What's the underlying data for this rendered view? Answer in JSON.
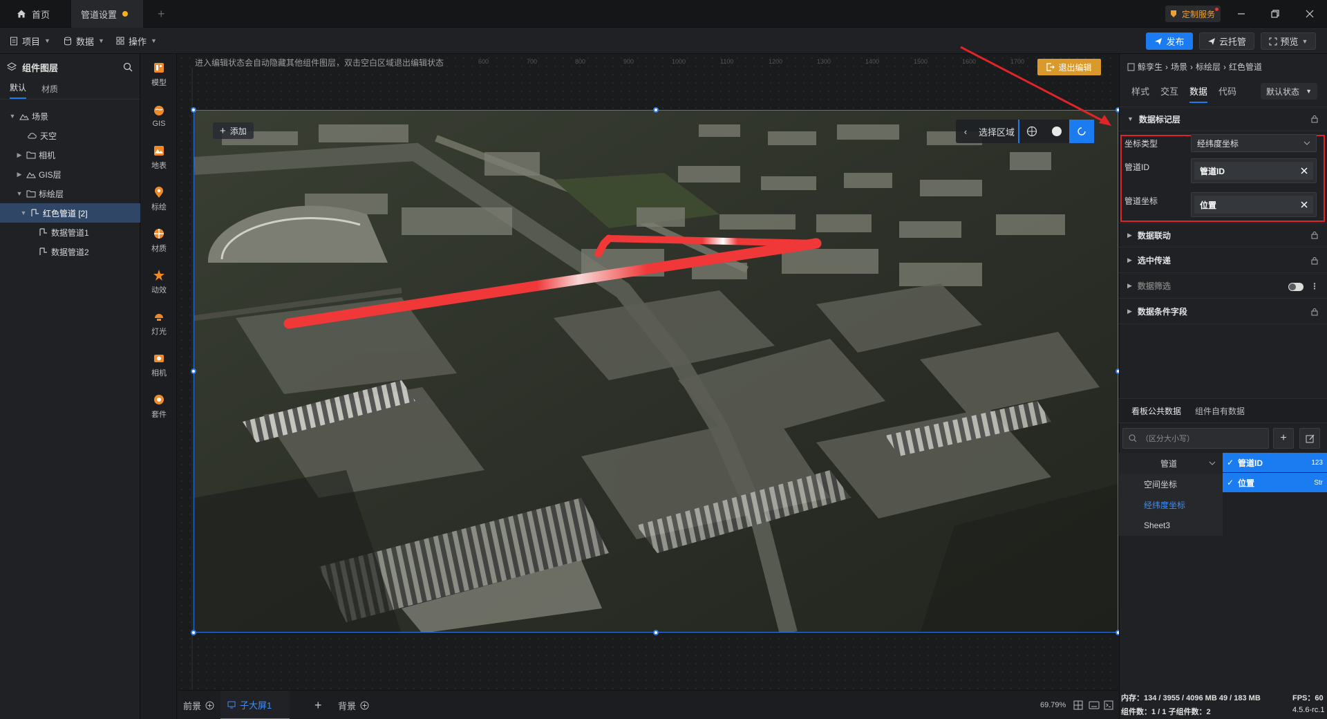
{
  "titlebar": {
    "tabs": [
      {
        "label": "首页"
      },
      {
        "label": "管道设置"
      }
    ],
    "custom_service": "定制服务"
  },
  "toolbar": {
    "menus": [
      {
        "label": "项目"
      },
      {
        "label": "数据"
      },
      {
        "label": "操作"
      }
    ],
    "publish": "发布",
    "cloud": "云托管",
    "preview": "预览"
  },
  "layers": {
    "title": "组件图层",
    "tabs": [
      "默认",
      "材质"
    ],
    "tree": [
      {
        "label": "场景"
      },
      {
        "label": "天空"
      },
      {
        "label": "相机"
      },
      {
        "label": "GIS层"
      },
      {
        "label": "标绘层"
      },
      {
        "label": "红色管道 [2]"
      },
      {
        "label": "数据管道1"
      },
      {
        "label": "数据管道2"
      }
    ]
  },
  "tools": [
    "模型",
    "GIS",
    "地表",
    "标绘",
    "材质",
    "动效",
    "灯光",
    "相机",
    "套件"
  ],
  "canvas": {
    "notice": "进入编辑状态会自动隐藏其他组件图层，双击空白区域退出编辑状态",
    "exit_edit": "退出编辑",
    "add": "添加",
    "region_select": "选择区域"
  },
  "bottombar": {
    "tabs": [
      {
        "label": "前景"
      },
      {
        "label": "子大屏1"
      },
      {
        "label": "背景"
      }
    ],
    "zoom": "69.79%"
  },
  "props": {
    "breadcrumb": [
      "鲸孪生",
      "场景",
      "标绘层",
      "红色管道"
    ],
    "tabs": [
      "样式",
      "交互",
      "数据",
      "代码"
    ],
    "state": "默认状态",
    "sections": {
      "marker_layer": "数据标记层",
      "linkage": "数据联动",
      "select_pass": "选中传递",
      "filter": "数据筛选",
      "condition": "数据条件字段"
    },
    "coord_type_label": "坐标类型",
    "coord_type_value": "经纬度坐标",
    "pipe_id_label": "管道ID",
    "pipe_id_value": "管道ID",
    "pipe_coord_label": "管道坐标",
    "pipe_coord_value": "位置",
    "data_tabs": [
      "看板公共数据",
      "组件自有数据"
    ],
    "search_placeholder": "（区分大小写）",
    "sources": [
      "管道",
      "空间坐标",
      "经纬度坐标",
      "Sheet3"
    ],
    "fields": [
      {
        "name": "管道ID",
        "type": "123"
      },
      {
        "name": "位置",
        "type": "Str"
      }
    ]
  },
  "status": {
    "memory": "内存：134 / 3955 / 4096 MB  49 / 183 MB",
    "fps": "FPS：60",
    "components": "组件数：1 / 1   子组件数：2",
    "version": "4.5.6-rc.1"
  },
  "ruler_ticks": [
    "600",
    "700",
    "800",
    "900",
    "1000",
    "1100",
    "1200",
    "1300",
    "1400",
    "1500",
    "1600",
    "1700",
    "1800"
  ],
  "colors": {
    "accent": "#1a7cf0",
    "highlight_border": "#e0242a",
    "pipe": "#f03838"
  }
}
